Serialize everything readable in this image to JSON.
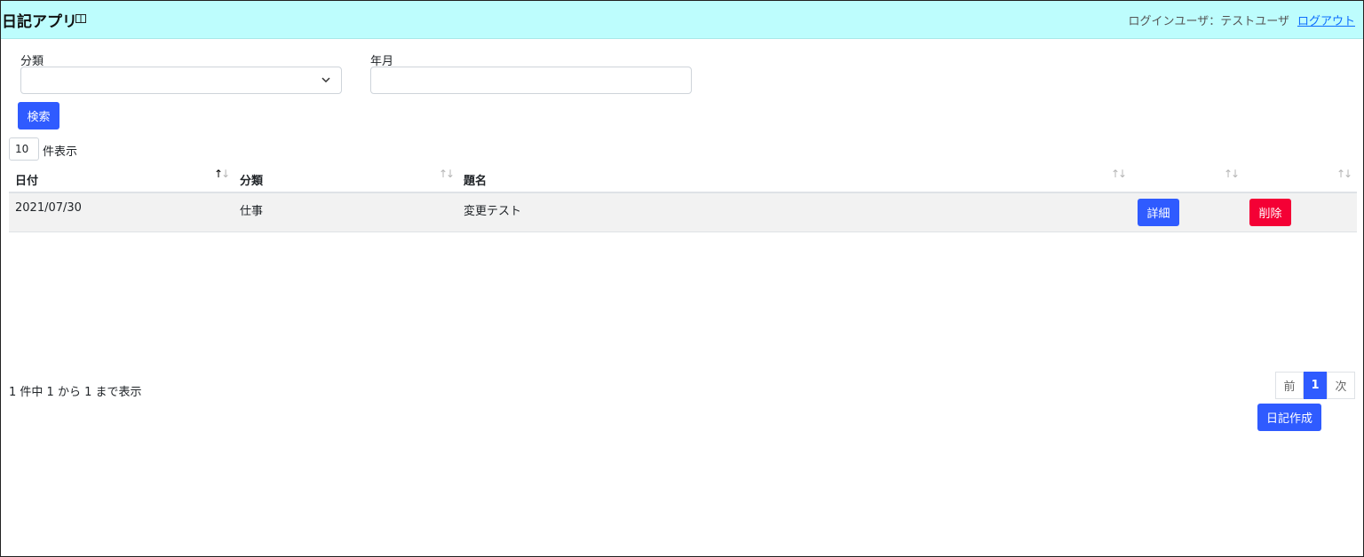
{
  "header": {
    "app_title": "日記アプリ",
    "user_label": "ログインユーザ：テストユーザ",
    "logout_label": "ログアウト"
  },
  "filters": {
    "category_label": "分類",
    "category_value": "",
    "yearmonth_label": "年月",
    "yearmonth_value": "",
    "search_label": "検索"
  },
  "table": {
    "page_length": "10",
    "page_length_label": "件表示",
    "columns": [
      "日付",
      "分類",
      "題名",
      "",
      ""
    ],
    "rows": [
      {
        "date": "2021/07/30",
        "category": "仕事",
        "title": "変更テスト",
        "detail_label": "詳細",
        "delete_label": "削除"
      }
    ],
    "info": "1 件中 1 から 1 まで表示"
  },
  "pagination": {
    "prev": "前",
    "current": "1",
    "next": "次"
  },
  "actions": {
    "create_label": "日記作成"
  },
  "colors": {
    "header_bg": "#bdfdfd",
    "primary": "#2f5bff",
    "danger": "#f40035",
    "link": "#0d6efd"
  }
}
